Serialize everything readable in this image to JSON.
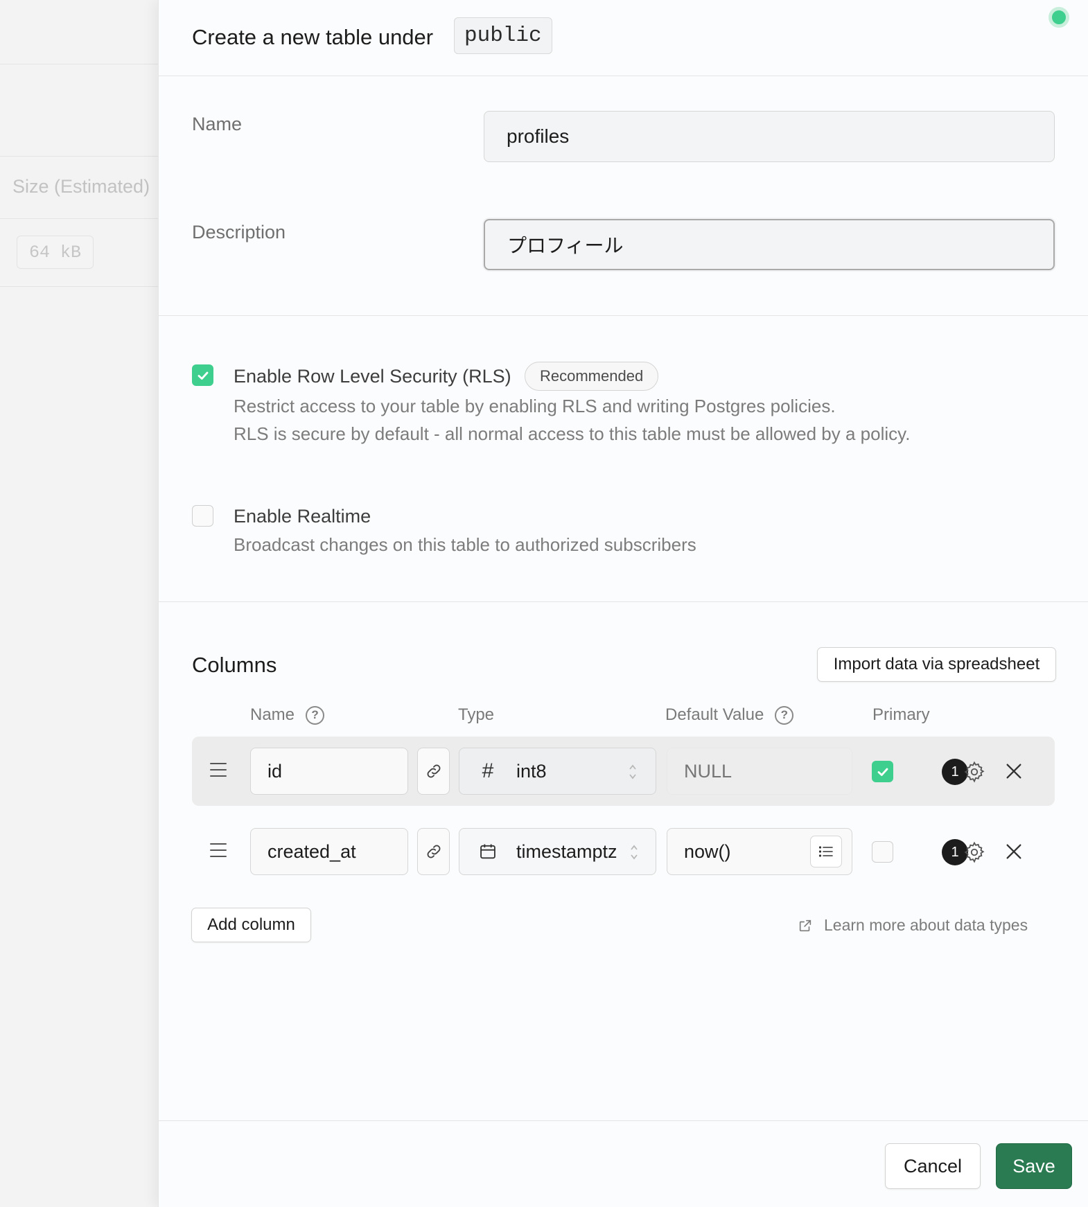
{
  "background": {
    "size_label": "Size (Estimated)",
    "size_value": "64 kB"
  },
  "panel": {
    "title": "Create a new table under",
    "schema": "public"
  },
  "form": {
    "name_label": "Name",
    "name_value": "profiles",
    "description_label": "Description",
    "description_value": "プロフィール"
  },
  "rls": {
    "checked": true,
    "title": "Enable Row Level Security (RLS)",
    "badge": "Recommended",
    "desc_line1": "Restrict access to your table by enabling RLS and writing Postgres policies.",
    "desc_line2": "RLS is secure by default - all normal access to this table must be allowed by a policy."
  },
  "realtime": {
    "checked": false,
    "title": "Enable Realtime",
    "desc": "Broadcast changes on this table to authorized subscribers"
  },
  "columns": {
    "title": "Columns",
    "import_button": "Import data via spreadsheet",
    "headers": {
      "name": "Name",
      "type": "Type",
      "default_value": "Default Value",
      "primary": "Primary"
    },
    "rows": [
      {
        "name": "id",
        "type": "int8",
        "type_icon": "hash-icon",
        "default_value": "",
        "default_placeholder": "NULL",
        "primary": true,
        "badge_count": "1"
      },
      {
        "name": "created_at",
        "type": "timestamptz",
        "type_icon": "calendar-icon",
        "default_value": "now()",
        "default_placeholder": "",
        "primary": false,
        "badge_count": "1"
      }
    ],
    "add_button": "Add column",
    "learn_more": "Learn more about data types"
  },
  "footer": {
    "cancel": "Cancel",
    "save": "Save"
  },
  "colors": {
    "accent_green": "#3ecf8e",
    "save_green": "#2a7a52"
  }
}
